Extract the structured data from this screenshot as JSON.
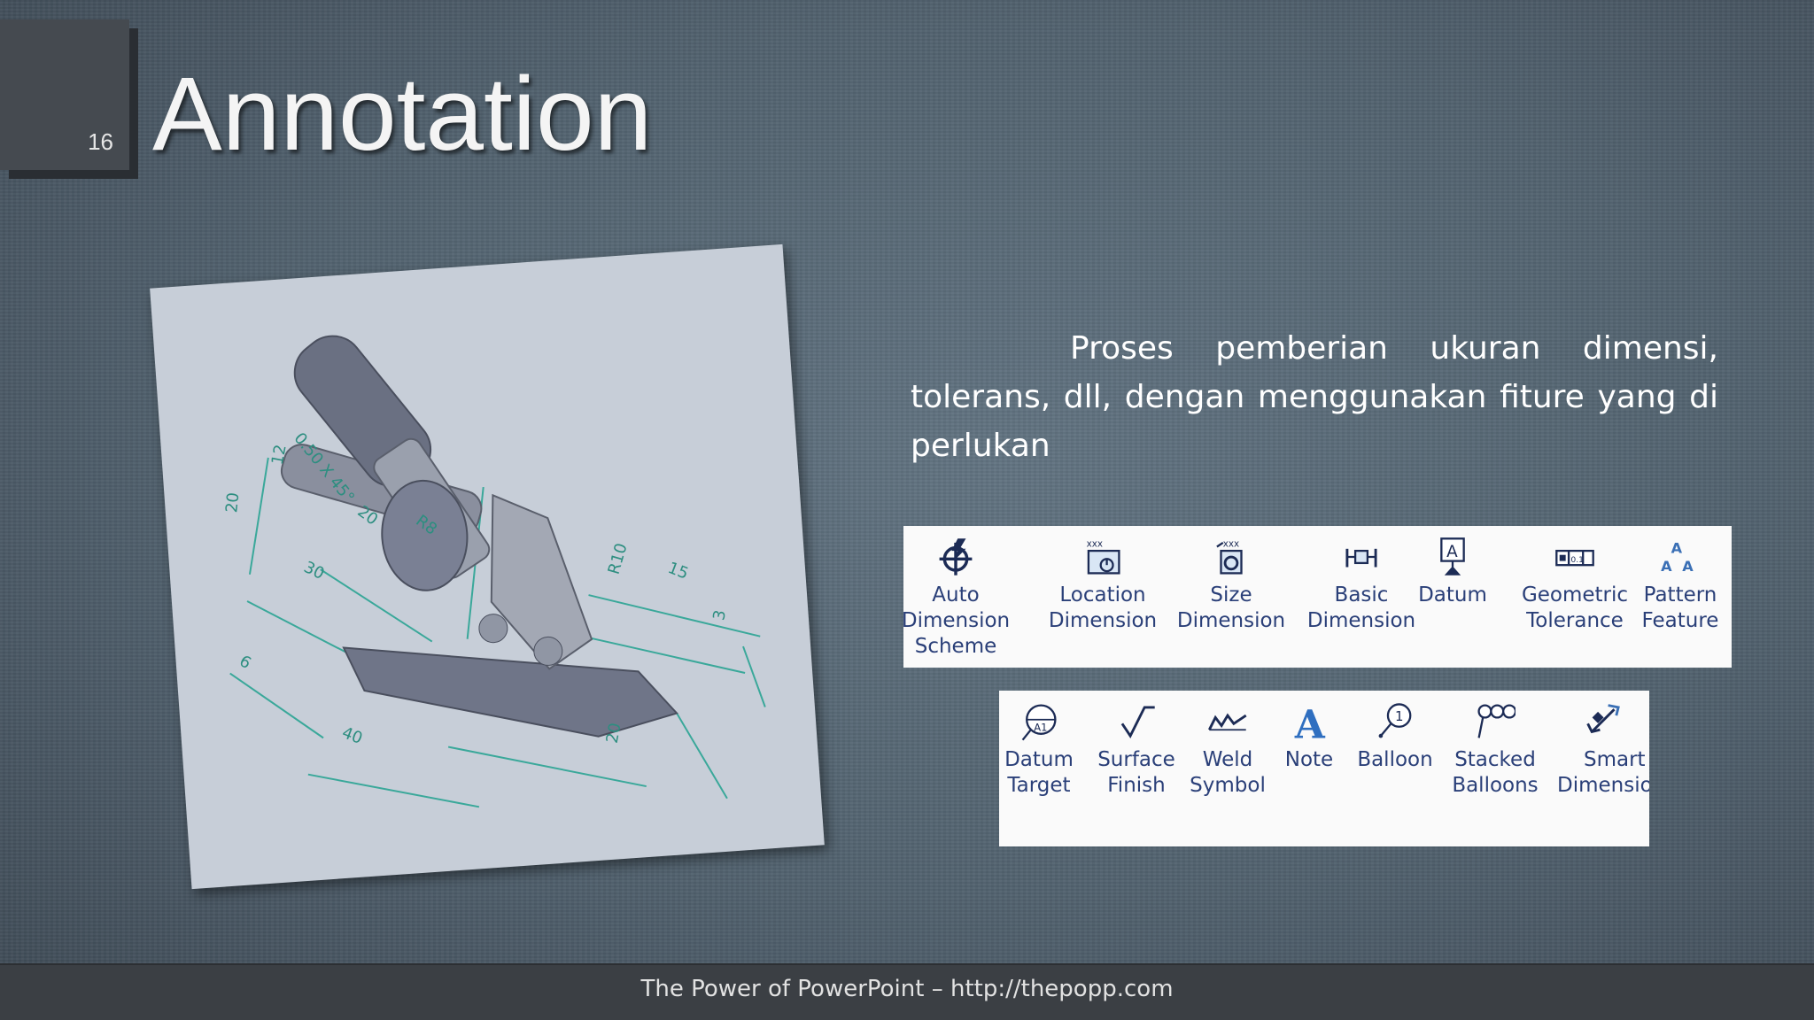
{
  "slide": {
    "number": "16",
    "title": "Annotation",
    "body": "Proses pemberian ukuran dimensi, tolerans, dll, dengan menggunakan fiture yang di perlukan",
    "footer": "The Power of PowerPoint – http://thepopp.com"
  },
  "drawing": {
    "dimensions": [
      "0.50 X 45°",
      "12",
      "20",
      "20",
      "30",
      "6",
      "40",
      "20",
      "3",
      "15",
      "R8",
      "R10"
    ]
  },
  "toolbar1": {
    "tools": [
      {
        "icon": "auto-dimension-scheme-icon",
        "line1": "Auto",
        "line2": "Dimension",
        "line3": "Scheme"
      },
      {
        "icon": "location-dimension-icon",
        "line1": "Location",
        "line2": "Dimension"
      },
      {
        "icon": "size-dimension-icon",
        "line1": "Size",
        "line2": "Dimension"
      },
      {
        "icon": "basic-dimension-icon",
        "line1": "Basic",
        "line2": "Dimension"
      },
      {
        "icon": "datum-icon",
        "line1": "Datum"
      },
      {
        "icon": "geometric-tolerance-icon",
        "line1": "Geometric",
        "line2": "Tolerance"
      },
      {
        "icon": "pattern-feature-icon",
        "line1": "Pattern",
        "line2": "Feature"
      }
    ]
  },
  "toolbar2": {
    "tools": [
      {
        "icon": "datum-target-icon",
        "line1": "Datum",
        "line2": "Target"
      },
      {
        "icon": "surface-finish-icon",
        "line1": "Surface",
        "line2": "Finish"
      },
      {
        "icon": "weld-symbol-icon",
        "line1": "Weld",
        "line2": "Symbol"
      },
      {
        "icon": "note-icon",
        "line1": "Note"
      },
      {
        "icon": "balloon-icon",
        "line1": "Balloon"
      },
      {
        "icon": "stacked-balloons-icon",
        "line1": "Stacked",
        "line2": "Balloons"
      },
      {
        "icon": "smart-dimension-icon",
        "line1": "Smart",
        "line2": "Dimensio"
      }
    ]
  },
  "colors": {
    "toolbar_text": "#2a3f78",
    "dimension_lines": "#3aa89a",
    "part_body": "#7e8496"
  }
}
